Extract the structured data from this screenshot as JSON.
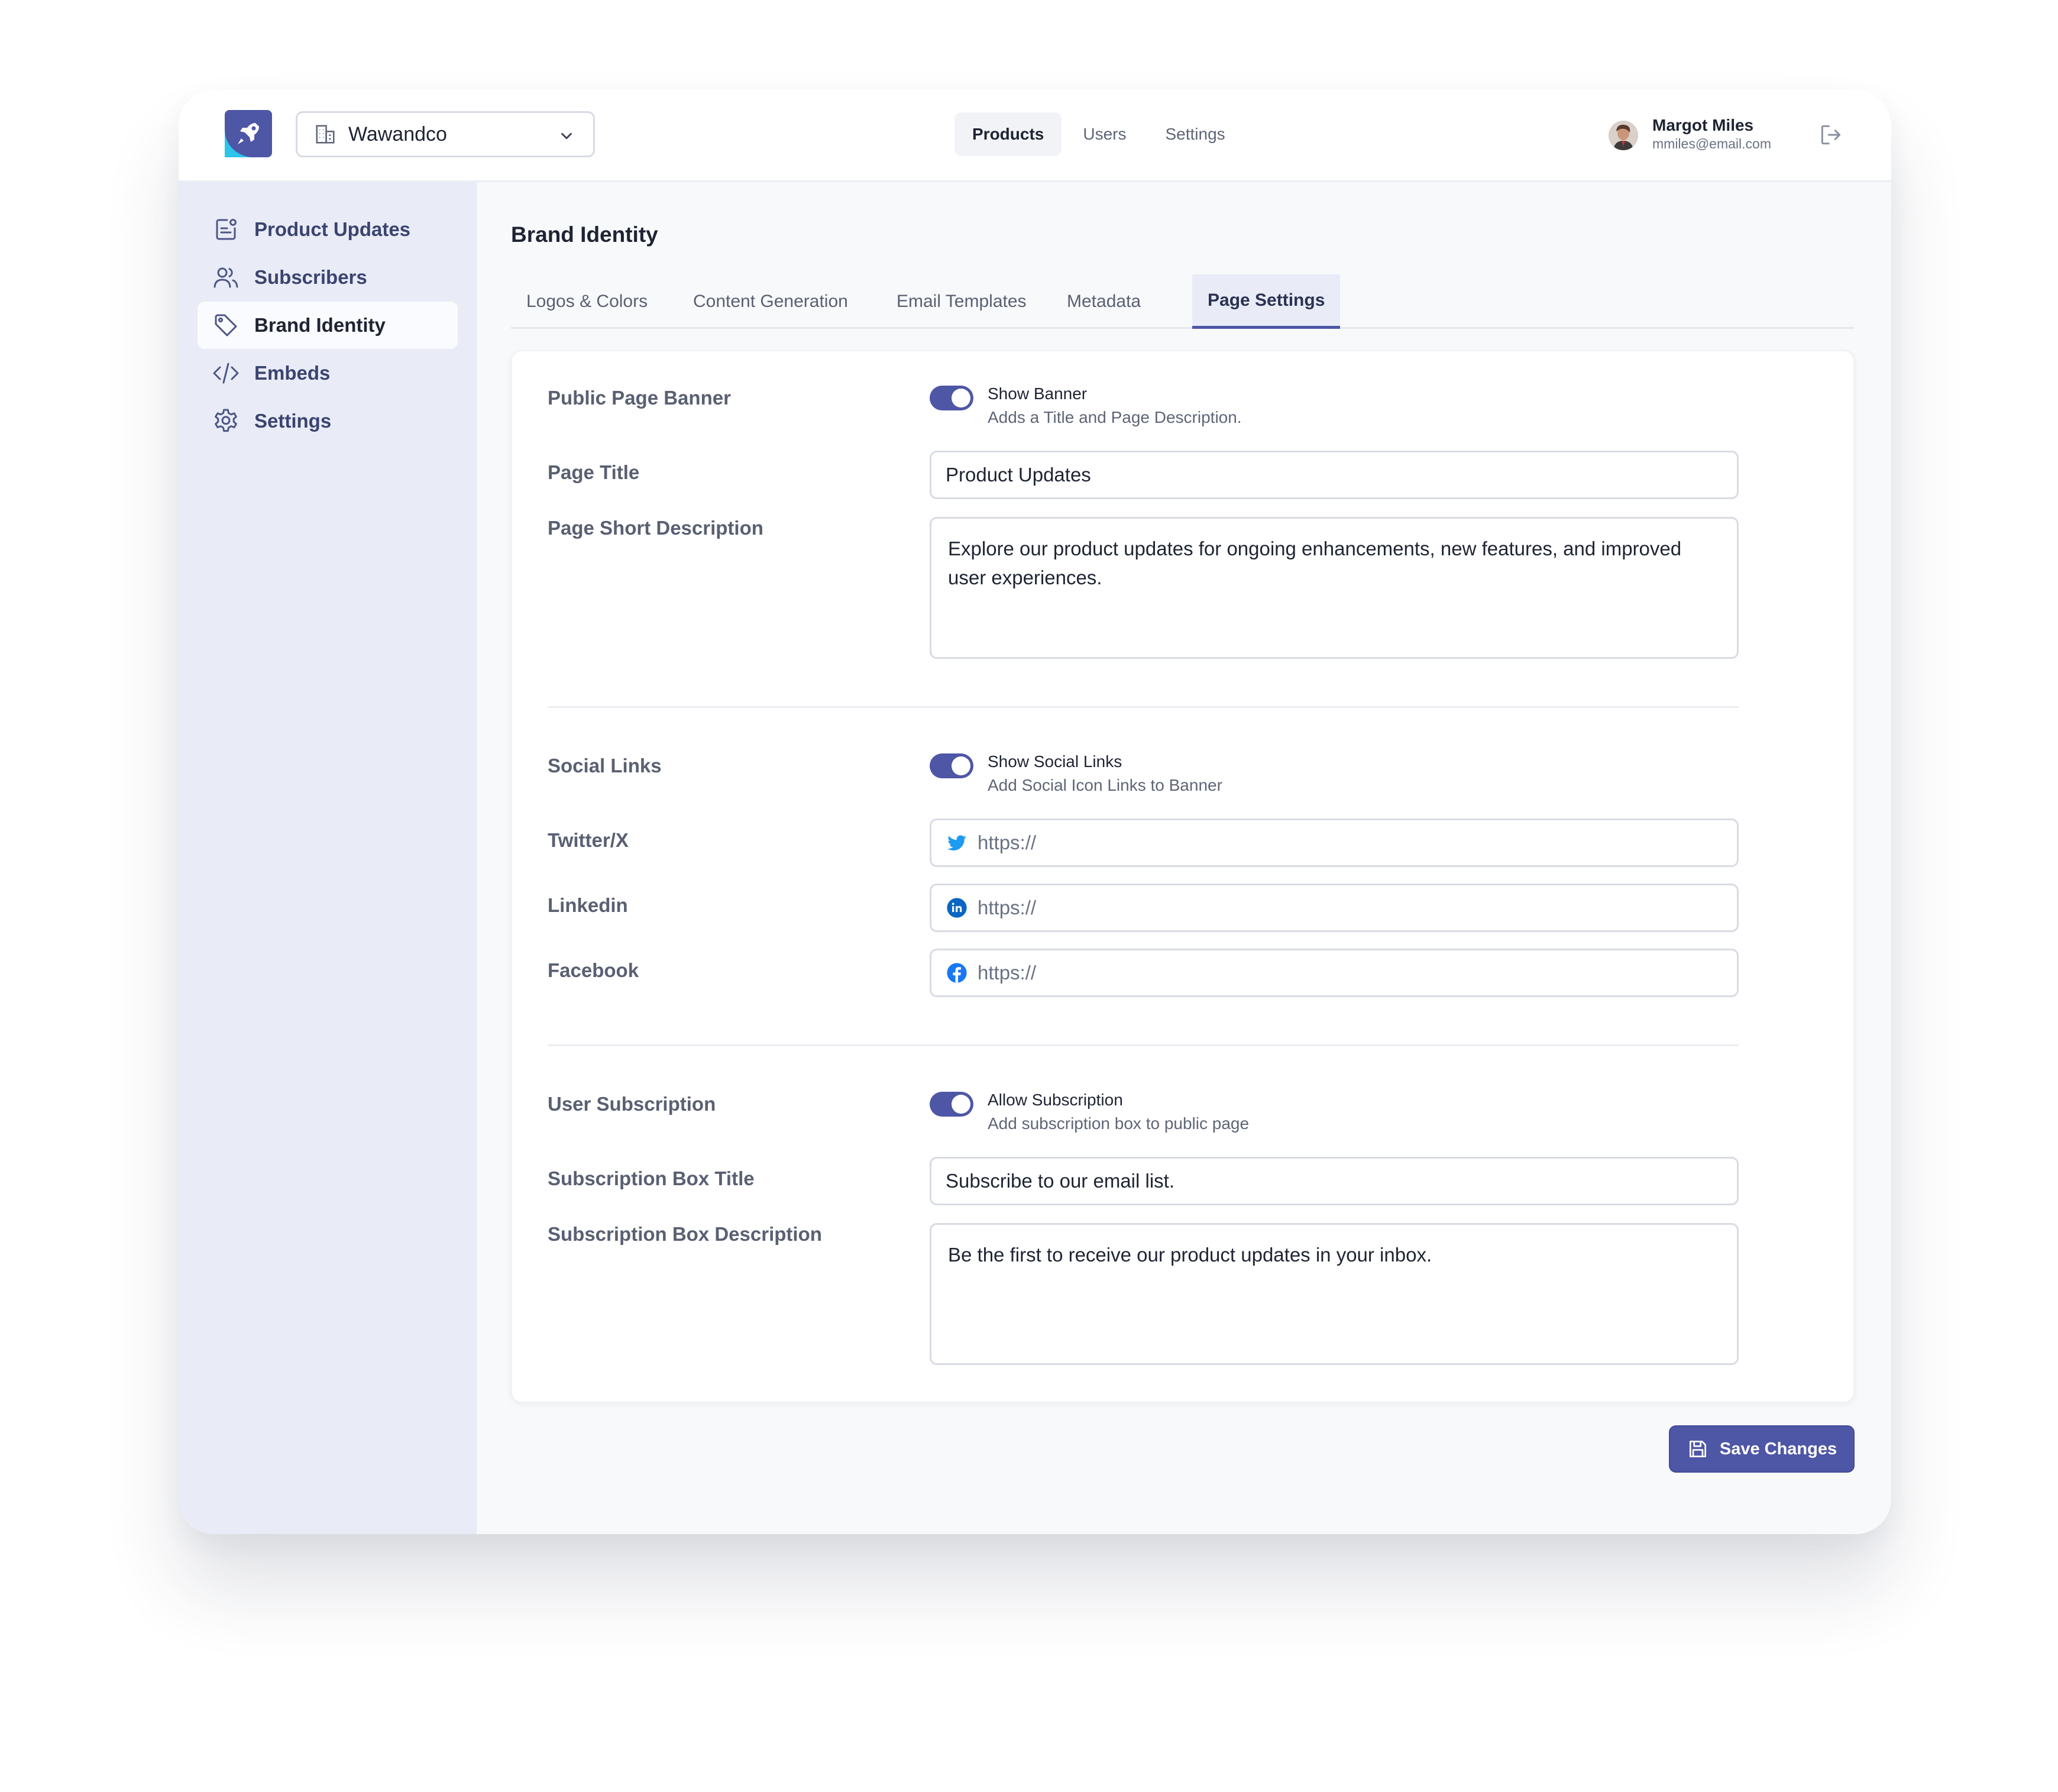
{
  "header": {
    "workspace_name": "Wawandco",
    "nav": [
      "Products",
      "Users",
      "Settings"
    ],
    "active_nav": "Products",
    "user_name": "Margot Miles",
    "user_email": "mmiles@email.com"
  },
  "sidebar": {
    "items": [
      {
        "label": "Product Updates",
        "icon": "document-icon"
      },
      {
        "label": "Subscribers",
        "icon": "users-icon"
      },
      {
        "label": "Brand Identity",
        "icon": "tag-icon",
        "active": true
      },
      {
        "label": "Embeds",
        "icon": "code-icon"
      },
      {
        "label": "Settings",
        "icon": "gear-icon"
      }
    ]
  },
  "main": {
    "title": "Brand Identity",
    "tabs": [
      "Logos & Colors",
      "Content Generation",
      "Email Templates",
      "Metadata",
      "Page Settings"
    ],
    "active_tab": "Page Settings"
  },
  "banner": {
    "label": "Public Page Banner",
    "toggle_title": "Show Banner",
    "toggle_sub": "Adds a Title and Page Description.",
    "toggle_on": true,
    "page_title_label": "Page Title",
    "page_title_value": "Product Updates",
    "desc_label": "Page Short Description",
    "desc_value": "Explore our product updates for ongoing enhancements, new features, and improved user experiences."
  },
  "social": {
    "label": "Social Links",
    "toggle_title": "Show Social Links",
    "toggle_sub": "Add Social Icon Links to Banner",
    "toggle_on": true,
    "twitter_label": "Twitter/X",
    "linkedin_label": "Linkedin",
    "facebook_label": "Facebook",
    "placeholder": "https://"
  },
  "subscription": {
    "label": "User Subscription",
    "toggle_title": "Allow Subscription",
    "toggle_sub": "Add subscription box to public page",
    "toggle_on": true,
    "box_title_label": "Subscription Box Title",
    "box_title_value": "Subscribe to our email list.",
    "box_desc_label": "Subscription Box Description",
    "box_desc_value": "Be the first to receive our product updates in your inbox."
  },
  "actions": {
    "save_label": "Save Changes"
  },
  "colors": {
    "accent": "#4e56a6",
    "sidebar_bg": "#e9ecf6",
    "twitter": "#1d9bf0",
    "linkedin": "#0a66c2",
    "facebook": "#1877f2"
  }
}
